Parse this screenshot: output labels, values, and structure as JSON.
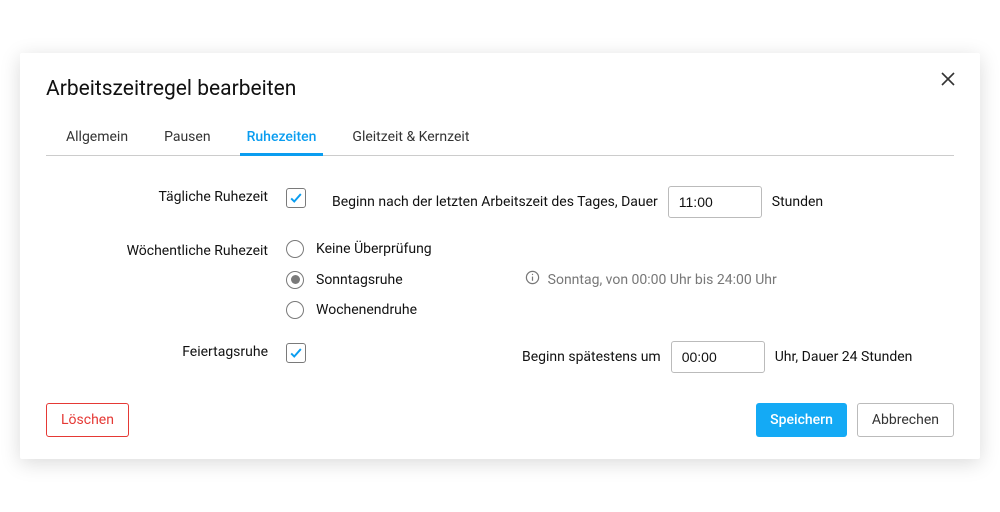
{
  "dialog": {
    "title": "Arbeitszeitregel bearbeiten"
  },
  "tabs": {
    "general": "Allgemein",
    "pauses": "Pausen",
    "rest": "Ruhezeiten",
    "flex": "Gleitzeit & Kernzeit"
  },
  "daily": {
    "label": "Tägliche Ruhezeit",
    "desc": "Beginn nach der letzten Arbeitszeit des Tages, Dauer",
    "value": "11:00",
    "unit": "Stunden"
  },
  "weekly": {
    "label": "Wöchentliche Ruhezeit",
    "options": {
      "none": "Keine Überprüfung",
      "sunday": "Sonntagsruhe",
      "weekend": "Wochenendruhe"
    },
    "info": "Sonntag, von 00:00 Uhr bis 24:00 Uhr"
  },
  "holiday": {
    "label": "Feiertagsruhe",
    "desc": "Beginn spätestens um",
    "value": "00:00",
    "unit": "Uhr, Dauer 24 Stunden"
  },
  "buttons": {
    "delete": "Löschen",
    "save": "Speichern",
    "cancel": "Abbrechen"
  }
}
